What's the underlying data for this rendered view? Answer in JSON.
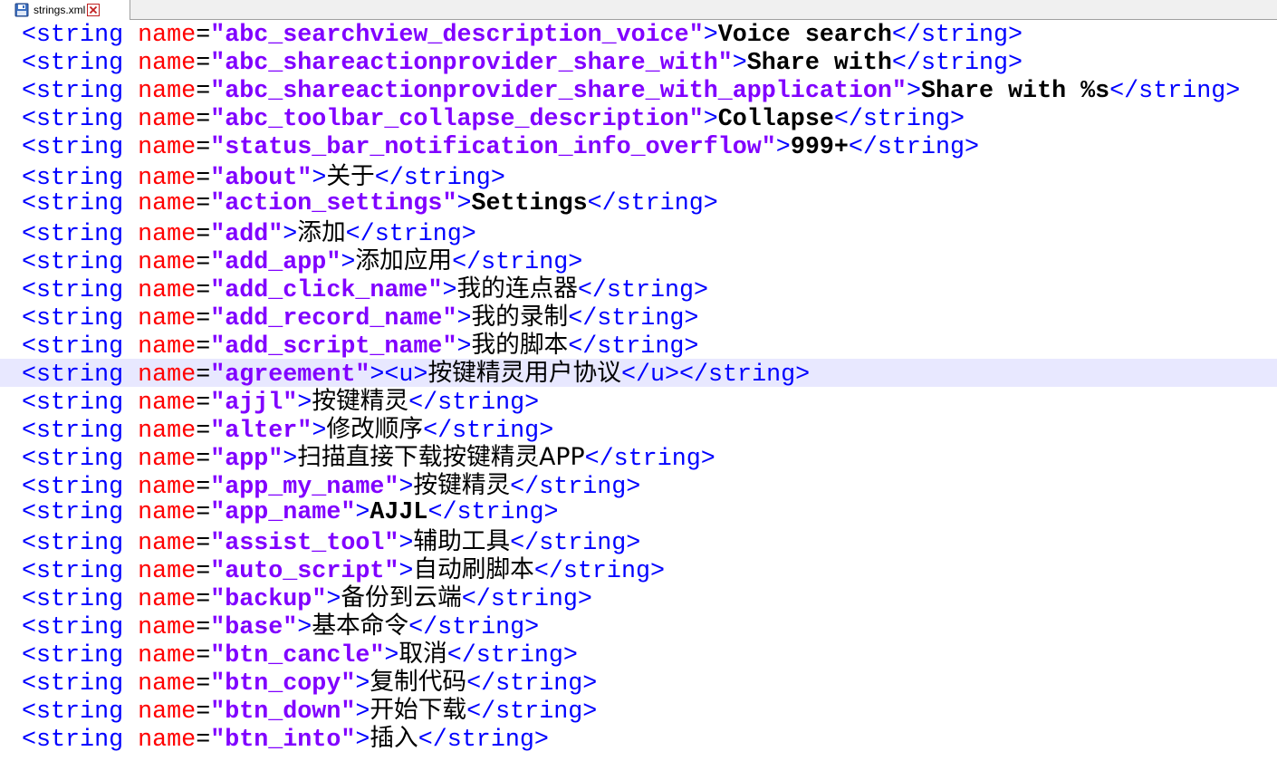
{
  "tab": {
    "label": "strings.xml",
    "file_icon": "save-disk-icon",
    "close_icon": "close-icon"
  },
  "colors": {
    "tag": "#0000ff",
    "attribute": "#ff0000",
    "value": "#8000ff",
    "text": "#000000",
    "current_line": "#e8e8ff"
  },
  "syntax": {
    "open_tag": "<string",
    "attr_name": "name",
    "equals": "=",
    "close_bracket": ">",
    "close_tag": "</string>"
  },
  "lines": [
    {
      "name": "abc_searchview_description_voice",
      "text": "Voice search"
    },
    {
      "name": "abc_shareactionprovider_share_with",
      "text": "Share with"
    },
    {
      "name": "abc_shareactionprovider_share_with_application",
      "text": "Share with %s"
    },
    {
      "name": "abc_toolbar_collapse_description",
      "text": "Collapse"
    },
    {
      "name": "status_bar_notification_info_overflow",
      "text": "999+"
    },
    {
      "name": "about",
      "text": "关于"
    },
    {
      "name": "action_settings",
      "text": "Settings"
    },
    {
      "name": "add",
      "text": "添加"
    },
    {
      "name": "add_app",
      "text": "添加应用"
    },
    {
      "name": "add_click_name",
      "text": "我的连点器"
    },
    {
      "name": "add_record_name",
      "text": "我的录制"
    },
    {
      "name": "add_script_name",
      "text": "我的脚本"
    },
    {
      "name": "agreement",
      "open_inner": "<u>",
      "text": "按键精灵用户协议",
      "close_inner": "</u>",
      "current": true
    },
    {
      "name": "ajjl",
      "text": "按键精灵"
    },
    {
      "name": "alter",
      "text": "修改顺序"
    },
    {
      "name": "app",
      "text": "扫描直接下载按键精灵APP"
    },
    {
      "name": "app_my_name",
      "text": "按键精灵"
    },
    {
      "name": "app_name",
      "text": "AJJL"
    },
    {
      "name": "assist_tool",
      "text": "辅助工具"
    },
    {
      "name": "auto_script",
      "text": "自动刷脚本"
    },
    {
      "name": "backup",
      "text": "备份到云端"
    },
    {
      "name": "base",
      "text": "基本命令"
    },
    {
      "name": "btn_cancle",
      "text": "取消"
    },
    {
      "name": "btn_copy",
      "text": "复制代码"
    },
    {
      "name": "btn_down",
      "text": "开始下载"
    },
    {
      "name": "btn_into",
      "text": "插入"
    }
  ]
}
